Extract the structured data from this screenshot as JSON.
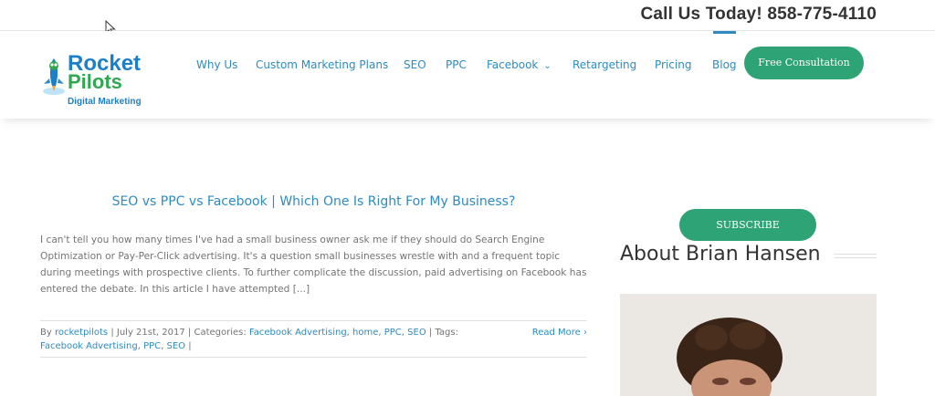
{
  "topbar": {
    "phone": "Call Us Today! 858-775-4110"
  },
  "logo": {
    "line1": "Rocket",
    "line2": "Pilots",
    "line3": "Digital Marketing"
  },
  "nav": {
    "items": [
      {
        "label": "Why Us"
      },
      {
        "label": "Custom Marketing Plans"
      },
      {
        "label": "SEO"
      },
      {
        "label": "PPC"
      },
      {
        "label": "Facebook"
      },
      {
        "label": "Retargeting"
      },
      {
        "label": "Pricing"
      },
      {
        "label": "Blog"
      }
    ],
    "cta_label": "Free Consultation"
  },
  "post": {
    "title": "SEO vs PPC vs Facebook | Which One Is Right For My Business?",
    "excerpt": "I can't tell you how many times I've had a small business owner ask me if they should do Search Engine Optimization or Pay-Per-Click advertising. It's a question small businesses wrestle with and a frequent topic during meetings with prospective clients. To further complicate the discussion, paid advertising on Facebook has entered the debate. In this article I have attempted [...]",
    "meta": {
      "by_prefix": "By",
      "author": "rocketpilots",
      "sep1": "|",
      "date": "July 21st, 2017",
      "sep2": "|",
      "categories_prefix": "Categories:",
      "categories": [
        "Facebook Advertising",
        "home",
        "PPC",
        "SEO"
      ],
      "sep3": "|",
      "tags_prefix": "Tags:",
      "tags": [
        "Facebook Advertising",
        "PPC",
        "SEO"
      ],
      "sep4": "|"
    },
    "read_more": "Read More"
  },
  "sidebar": {
    "subscribe_label": "SUBSCRIBE",
    "about_heading": "About Brian Hansen"
  },
  "colors": {
    "accent_blue": "#2e8bc0",
    "cta_green": "#2ea375",
    "heading_dark": "#333333"
  }
}
